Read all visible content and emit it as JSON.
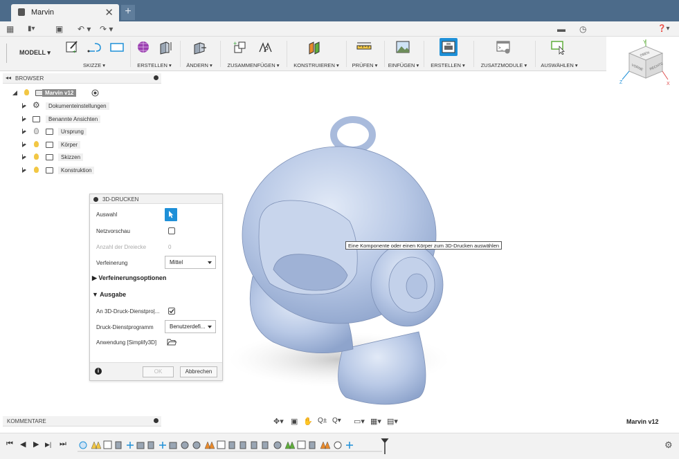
{
  "window": {
    "tab_title": "Marvin",
    "tab_close": "✕",
    "new_tab": "+"
  },
  "quick_access": {
    "grid": "▦",
    "file": "▮▾",
    "save": "▣",
    "undo": "↶ ▾",
    "redo": "↷ ▾",
    "notifications": "▬",
    "history": "◷",
    "help": "❓▾"
  },
  "ribbon": {
    "mode": "MODELL ▾",
    "groups": [
      {
        "label": "SKIZZE ▾"
      },
      {
        "label": "ERSTELLEN ▾"
      },
      {
        "label": "ÄNDERN ▾"
      },
      {
        "label": "ZUSAMMENFÜGEN ▾"
      },
      {
        "label": "KONSTRUIEREN ▾"
      },
      {
        "label": "PRÜFEN ▾"
      },
      {
        "label": "EINFÜGEN ▾"
      },
      {
        "label": "ERSTELLEN ▾"
      },
      {
        "label": "ZUSATZMODULE ▾"
      },
      {
        "label": "AUSWÄHLEN ▾"
      }
    ]
  },
  "viewcube": {
    "top": "OBEN",
    "front": "VORNE",
    "right": "RECHTS",
    "x": "X",
    "y": "Y",
    "z": "Z"
  },
  "browser": {
    "title": "BROWSER",
    "collapse": "◂◂",
    "root": "Marvin v12",
    "items": [
      {
        "label": "Dokumenteinstellungen",
        "icon": "gear-icon"
      },
      {
        "label": "Benannte Ansichten",
        "icon": "folder-icon"
      },
      {
        "label": "Ursprung",
        "icon": "folder-icon"
      },
      {
        "label": "Körper",
        "icon": "folder-icon"
      },
      {
        "label": "Skizzen",
        "icon": "folder-icon"
      },
      {
        "label": "Konstruktion",
        "icon": "folder-icon"
      }
    ]
  },
  "print_dialog": {
    "title": "3D-DRUCKEN",
    "selection_label": "Auswahl",
    "mesh_preview_label": "Netzvorschau",
    "triangle_count_label": "Anzahl der Dreiecke",
    "triangle_count_value": "0",
    "refinement_label": "Verfeinerung",
    "refinement_value": "Mittel",
    "refinement_options_label": "▶ Verfeinerungsoptionen",
    "output_label": "▼ Ausgabe",
    "send_to_service_label": "An 3D-Druck-Dienstpro|...",
    "print_service_label": "Druck-Dienstprogramm",
    "print_service_value": "Benutzerdefi...",
    "application_label": "Anwendung [Simplify3D]",
    "info": "i",
    "ok_label": "OK",
    "cancel_label": "Abbrechen"
  },
  "tooltip": "Eine Komponente oder einen Körper zum 3D-Drucken auswählen",
  "comments": {
    "title": "KOMMENTARE"
  },
  "navigation_toolbar": {
    "orbit": "✥▾",
    "look": "▣",
    "pan": "✋",
    "zoom": "Q±",
    "fit": "Q▾",
    "display": "▭▾",
    "grid": "▦▾",
    "viewports": "▤▾"
  },
  "document_name": "Marvin v12",
  "timeline": {
    "first": "⏮",
    "prev": "◀",
    "play": "▶",
    "next": "▶|",
    "last": "⏭",
    "settings": "⚙"
  },
  "colors": {
    "titlebar": "#4c6b8a",
    "accent": "#1e90d8",
    "model": "#b8c9e6",
    "panel": "#f2f2f2"
  }
}
